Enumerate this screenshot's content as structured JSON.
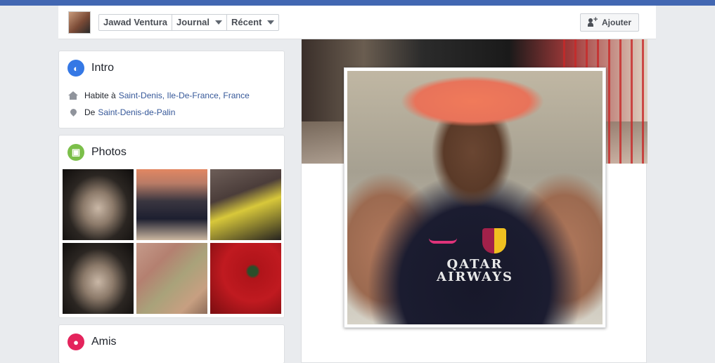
{
  "header": {
    "profile_name": "Jawad Ventura",
    "journal_label": "Journal",
    "recent_label": "Récent",
    "add_friend_label": "Ajouter"
  },
  "intro": {
    "title": "Intro",
    "lives_prefix": "Habite à",
    "lives_in": "Saint-Denis, Ile-De-France, France",
    "from_prefix": "De",
    "from": "Saint-Denis-de-Palin"
  },
  "photos": {
    "title": "Photos",
    "count": 6
  },
  "friends": {
    "title": "Amis"
  },
  "profile_picture": {
    "jersey_text_line1": "QATAR",
    "jersey_text_line2": "AIRWAYS"
  },
  "colors": {
    "top_bar": "#4267b2",
    "intro_icon": "#3578e5",
    "photos_icon": "#7bbf4a",
    "friends_icon": "#e4245c",
    "link": "#365899"
  },
  "icons": [
    "globe-icon",
    "home-icon",
    "location-pin-icon",
    "photo-icon",
    "friends-icon",
    "add-friend-icon",
    "chevron-down-icon"
  ]
}
